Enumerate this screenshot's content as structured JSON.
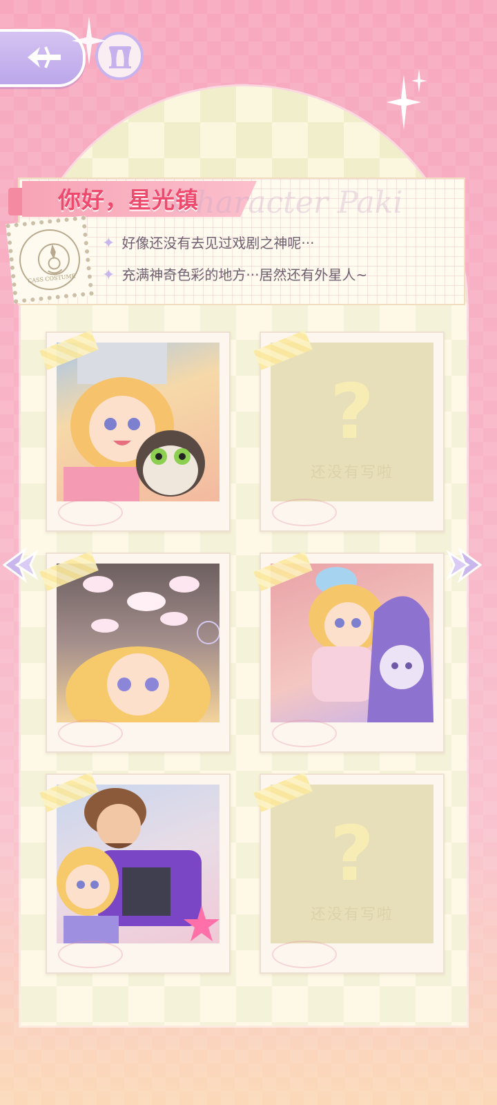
{
  "header": {
    "title": "你好，星光镇",
    "watermark": "Character Paki",
    "stamp_text": "CASS COSTUME",
    "notes": [
      "好像还没有去见过戏剧之神呢···",
      "充满神奇色彩的地方···居然还有外星人~"
    ]
  },
  "photos": [
    {
      "kind": "image",
      "scene": "girl-with-bucket-hat-and-cat"
    },
    {
      "kind": "empty",
      "mark": "?",
      "caption": "还没有写啦"
    },
    {
      "kind": "image",
      "scene": "ballet-dancers-above-girl"
    },
    {
      "kind": "image",
      "scene": "girl-and-purple-alien"
    },
    {
      "kind": "image",
      "scene": "bearded-man-in-purple-jacket-and-girl"
    },
    {
      "kind": "empty",
      "mark": "?",
      "caption": "还没有写啦"
    }
  ],
  "icons": {
    "back": "back-arrow-icon",
    "home": "stage-curtain-icon",
    "prev": "chevron-left-icon",
    "next": "chevron-right-icon"
  },
  "colors": {
    "accent_pink": "#ee4a6e",
    "lavender": "#c8b6ec",
    "panel": "#fbf6de"
  }
}
